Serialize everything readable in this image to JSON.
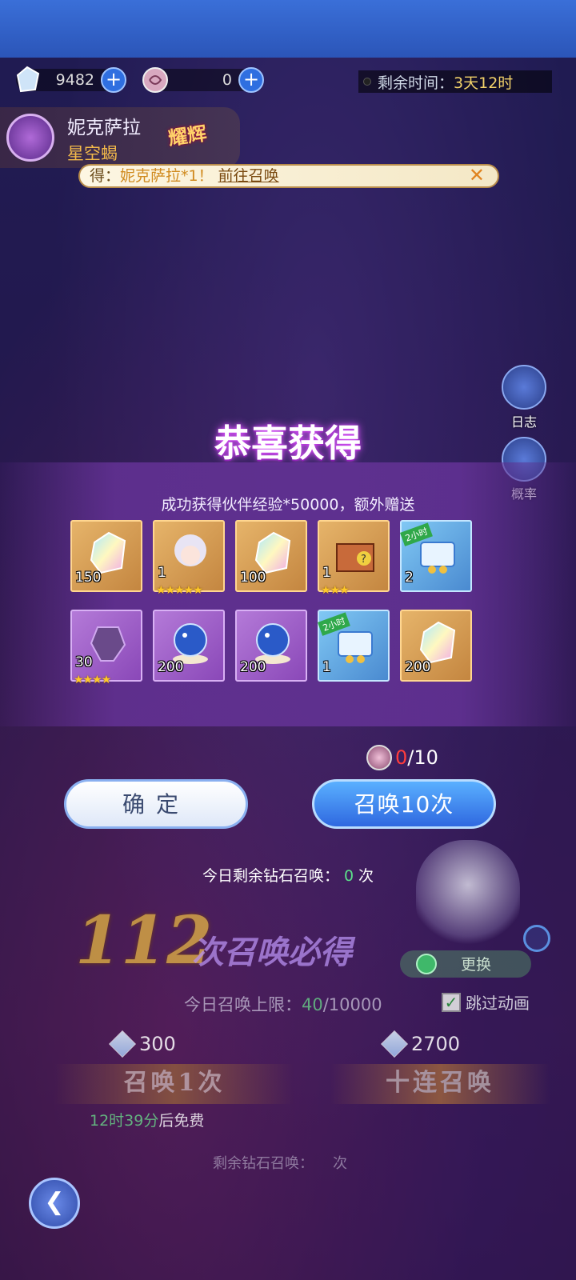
{
  "currencies": [
    {
      "name": "gem",
      "value": "9482"
    },
    {
      "name": "summon-token",
      "value": "0"
    }
  ],
  "timer": {
    "label": "剩余时间：",
    "value": "3天12时"
  },
  "hero": {
    "name": "妮克萨拉",
    "title": "星空蝎",
    "badge": "耀辉"
  },
  "notice": {
    "prefix": "得：",
    "highlight": "妮克萨拉*1",
    "excl": "！",
    "link": "前往召唤",
    "close": "✕"
  },
  "side": {
    "log": "日志",
    "rate": "概率"
  },
  "modal": {
    "title": "恭喜获得",
    "subtitle": "成功获得伙伴经验*50000，额外赠送",
    "items": [
      {
        "icon": "rainbow-crystal-icon",
        "qty": "150",
        "stars": 0,
        "bg": "gold"
      },
      {
        "icon": "hero-portrait-icon",
        "qty": "1",
        "stars": 5,
        "bg": "gold"
      },
      {
        "icon": "rainbow-crystal-icon",
        "qty": "100",
        "stars": 0,
        "bg": "gold"
      },
      {
        "icon": "mystery-box-icon",
        "qty": "1",
        "stars": 3,
        "bg": "gold"
      },
      {
        "icon": "treasure-chest-icon",
        "qty": "2",
        "stars": 0,
        "bg": "blue",
        "tag": "2小时"
      },
      {
        "icon": "shard-icon",
        "qty": "30",
        "stars": 4,
        "bg": "purple"
      },
      {
        "icon": "star-orb-icon",
        "qty": "200",
        "stars": 0,
        "bg": "purple"
      },
      {
        "icon": "star-orb-icon",
        "qty": "200",
        "stars": 0,
        "bg": "purple"
      },
      {
        "icon": "treasure-chest-icon",
        "qty": "1",
        "stars": 0,
        "bg": "blue",
        "tag": "2小时"
      },
      {
        "icon": "rainbow-crystal-icon",
        "qty": "200",
        "stars": 0,
        "bg": "gold"
      }
    ],
    "counter": {
      "current": "0",
      "total": "/10"
    },
    "confirm": "确定",
    "summon10": "召唤10次",
    "remain_label": "今日剩余钻石召唤：",
    "remain_value": "0",
    "remain_unit": "次"
  },
  "background": {
    "guarantee_number": "112",
    "guarantee_text": "次召唤必得",
    "swap": "更换",
    "limit_label": "今日召唤上限：",
    "limit_used": "40",
    "limit_total": "/10000",
    "skip": "跳过动画",
    "cost_one": "300",
    "cost_ten": "2700",
    "summon_one": "召唤1次",
    "summon_ten": "十连召唤",
    "free_time": "12时39分",
    "free_suffix": "后免费",
    "remain2_label": "剩余钻石召唤：",
    "remain2_unit": "次"
  },
  "colors": {
    "accent_gold": "#f0c040",
    "accent_blue": "#2f68e0",
    "warn_red": "#ff3c3c",
    "ok_green": "#5ce08a"
  }
}
